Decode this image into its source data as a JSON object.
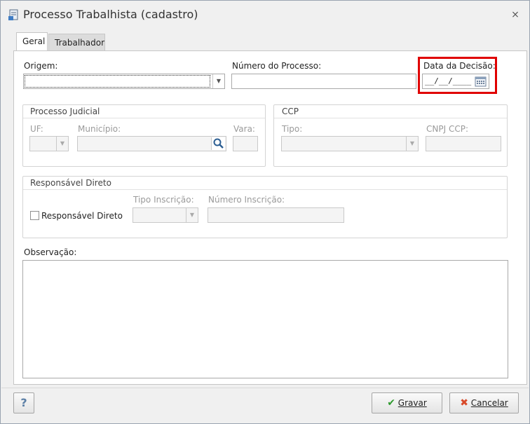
{
  "window": {
    "title": "Processo Trabalhista (cadastro)"
  },
  "tabs": [
    {
      "label": "Geral"
    },
    {
      "label": "Trabalhador"
    }
  ],
  "fields": {
    "origem": {
      "label": "Origem:",
      "value": ""
    },
    "numero_processo": {
      "label": "Número do Processo:",
      "value": ""
    },
    "data_decisao": {
      "label": "Data da Decisão:",
      "mask": "__/__/____"
    }
  },
  "processo_judicial": {
    "title": "Processo Judicial",
    "uf_label": "UF:",
    "municipio_label": "Município:",
    "vara_label": "Vara:"
  },
  "ccp": {
    "title": "CCP",
    "tipo_label": "Tipo:",
    "cnpj_label": "CNPJ CCP:"
  },
  "responsavel": {
    "title": "Responsável Direto",
    "checkbox_label": "Responsável Direto",
    "tipo_inscricao_label": "Tipo Inscrição:",
    "numero_inscricao_label": "Número Inscrição:"
  },
  "observacao": {
    "label": "Observação:",
    "value": ""
  },
  "footer": {
    "help_label": "?",
    "gravar_label": "Gravar",
    "cancelar_label": "Cancelar"
  },
  "colors": {
    "highlight": "#e00000",
    "gravar_check": "#2e9a2e",
    "cancel_x": "#d84a2a"
  }
}
